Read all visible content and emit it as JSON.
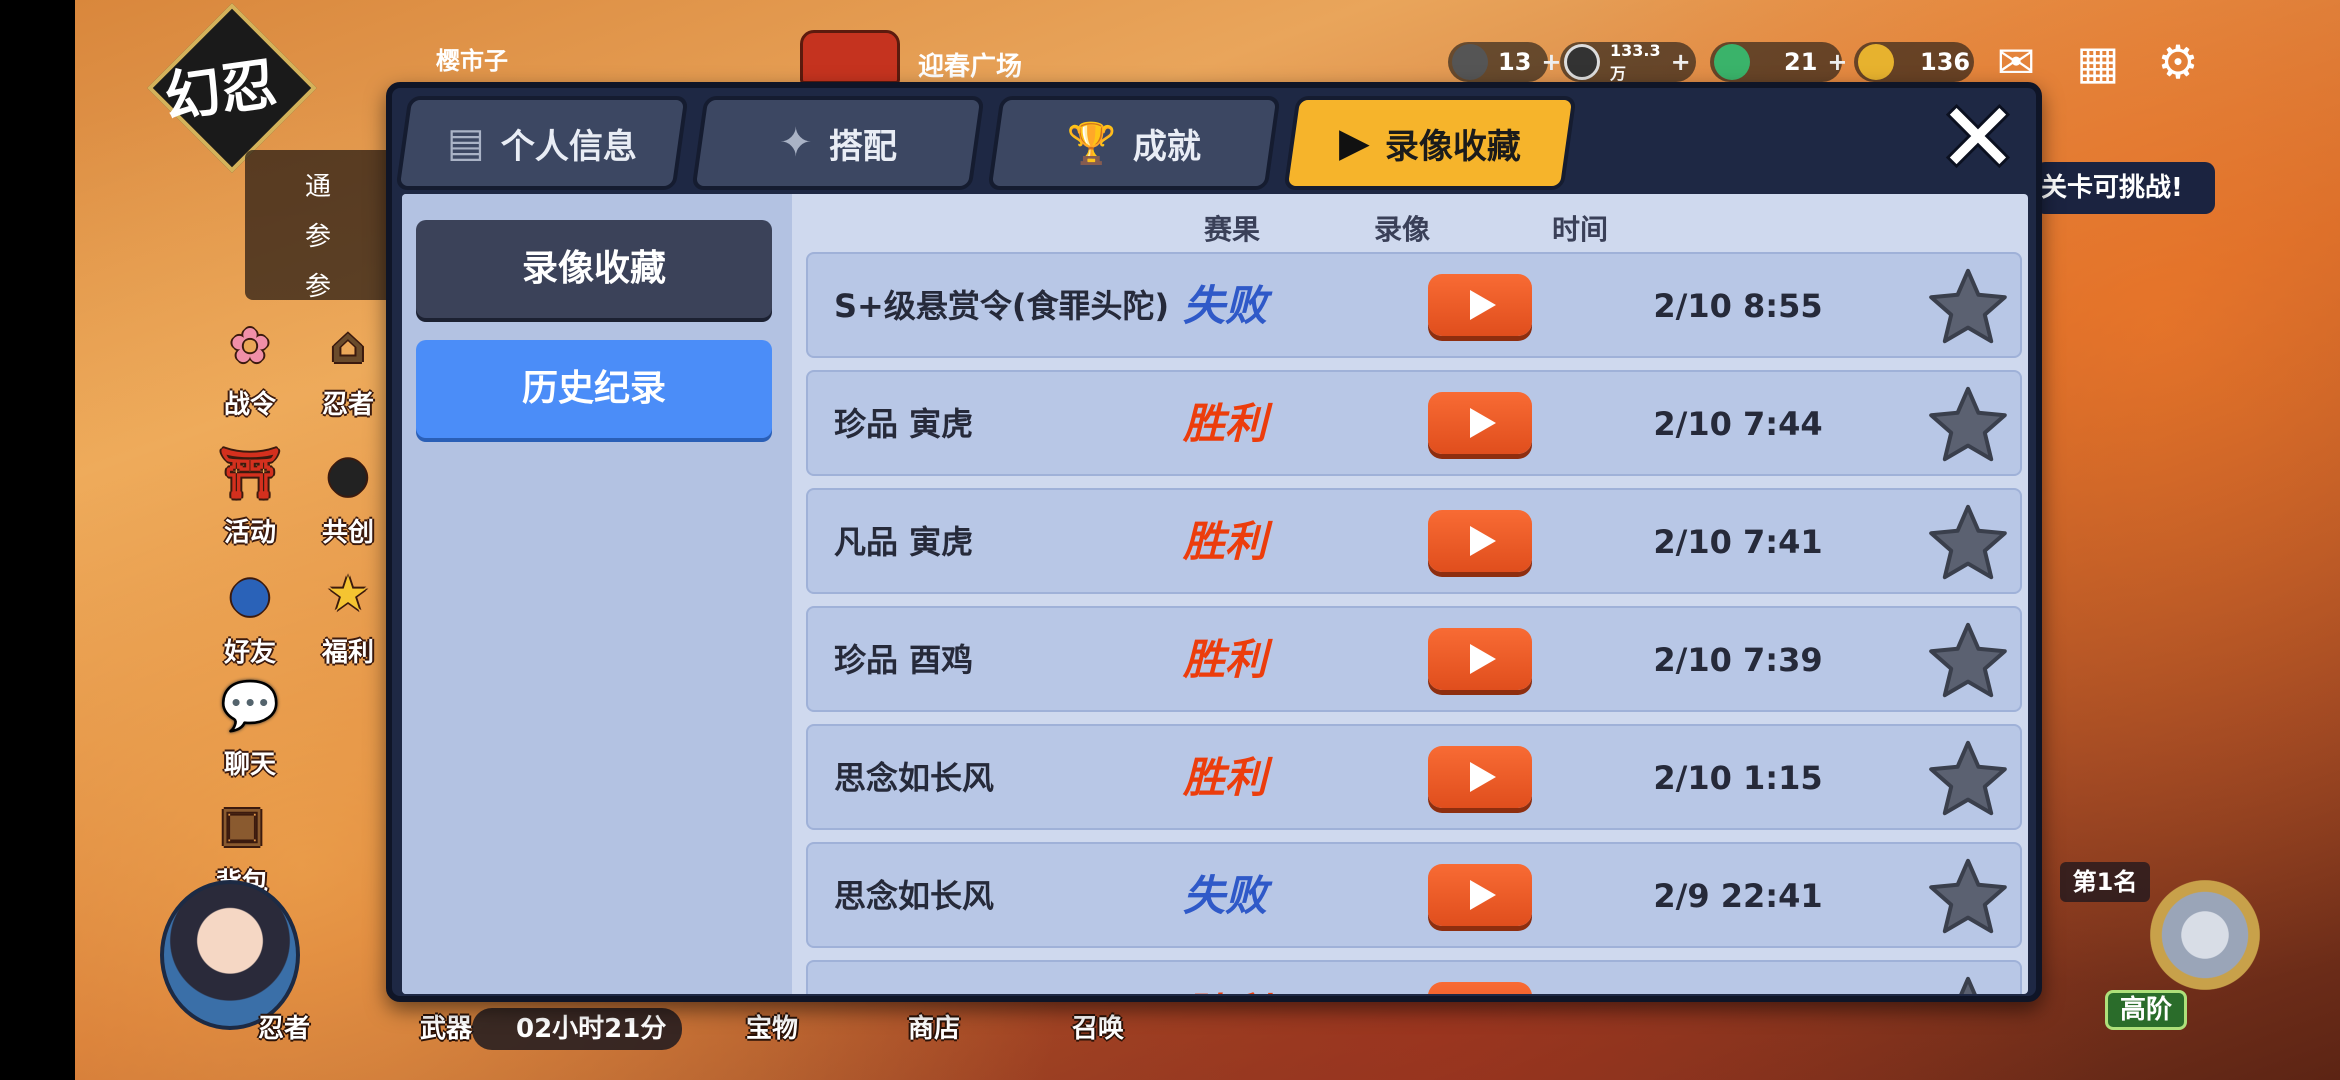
{
  "hud": {
    "player_name": "樱市子",
    "event_name": "迎春广场",
    "resources": [
      {
        "icon": "scroll-icon",
        "value": "13"
      },
      {
        "icon": "coin-icon",
        "value": "133.3万"
      },
      {
        "icon": "green-magatama-icon",
        "value": "21"
      },
      {
        "icon": "gold-magatama-icon",
        "value": "136"
      }
    ]
  },
  "game_logo": "幻忍",
  "quest_items": [
    "通",
    "参",
    "参"
  ],
  "side_menu": [
    "战令",
    "忍者",
    "活动",
    "共创",
    "好友",
    "福利",
    "聊天",
    "背包"
  ],
  "bottom_bar": {
    "timer": "02小时21分",
    "labels": [
      "忍者",
      "武器",
      "宝物",
      "商店",
      "召唤"
    ]
  },
  "right_panel": {
    "challenge_banner": "关卡可挑战!",
    "rank": "第1名",
    "tier": "高阶"
  },
  "modal": {
    "tabs": [
      {
        "label": "个人信息",
        "icon": "id-card-icon"
      },
      {
        "label": "搭配",
        "icon": "shuriken-icon"
      },
      {
        "label": "成就",
        "icon": "trophy-icon"
      },
      {
        "label": "录像收藏",
        "icon": "play-icon",
        "active": true
      }
    ],
    "sidebar": {
      "favorites": "录像收藏",
      "history": "历史纪录"
    },
    "columns": {
      "result": "赛果",
      "video": "录像",
      "time": "时间"
    },
    "rows": [
      {
        "name": "S+级悬赏令(食罪头陀)",
        "result": "失败",
        "outcome": "lose",
        "time": "2/10 8:55"
      },
      {
        "name": "珍品 寅虎",
        "result": "胜利",
        "outcome": "win",
        "time": "2/10 7:44"
      },
      {
        "name": "凡品 寅虎",
        "result": "胜利",
        "outcome": "win",
        "time": "2/10 7:41"
      },
      {
        "name": "珍品 酉鸡",
        "result": "胜利",
        "outcome": "win",
        "time": "2/10 7:39"
      },
      {
        "name": "思念如长风",
        "result": "胜利",
        "outcome": "win",
        "time": "2/10 1:15"
      },
      {
        "name": "思念如长风",
        "result": "失败",
        "outcome": "lose",
        "time": "2/9 22:41"
      },
      {
        "name": "",
        "result": "胜利",
        "outcome": "win",
        "time": ""
      }
    ]
  },
  "colors": {
    "active_tab": "#f6b42b",
    "history_button": "#4b8df8",
    "play_button": "#e85a26",
    "win_text": "#ec3d0c",
    "lose_text": "#2f59c8"
  }
}
